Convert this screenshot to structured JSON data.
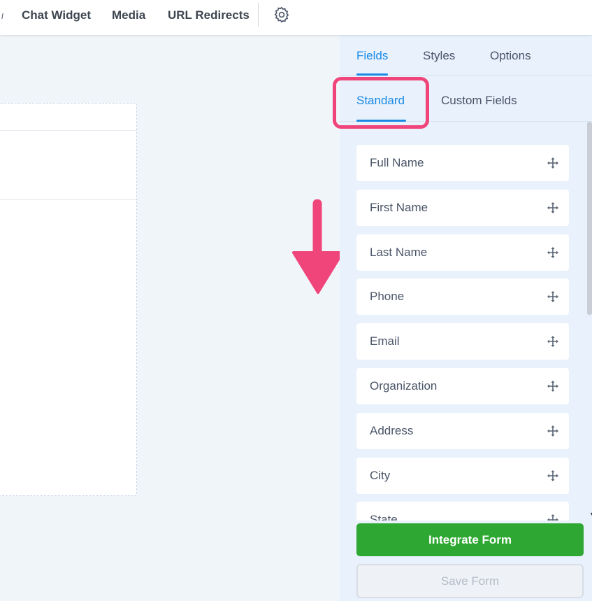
{
  "topnav": {
    "items": [
      "Chat Widget",
      "Media",
      "URL Redirects"
    ],
    "settings_icon": "gear-icon"
  },
  "panel": {
    "tabs": [
      "Fields",
      "Styles",
      "Options"
    ],
    "active_tab": "Fields",
    "sub_tabs": [
      "Standard",
      "Custom Fields"
    ],
    "active_sub_tab": "Standard",
    "fields": [
      "Full Name",
      "First Name",
      "Last Name",
      "Phone",
      "Email",
      "Organization",
      "Address",
      "City",
      "State"
    ],
    "field_icon": "move-icon",
    "integrate_button": "Integrate Form",
    "save_button": "Save Form"
  },
  "annotations": {
    "highlight_color": "#f0457a",
    "arrow_icon": "down-arrow-icon"
  },
  "colors": {
    "accent": "#1a8ae5",
    "success": "#2ea832"
  }
}
